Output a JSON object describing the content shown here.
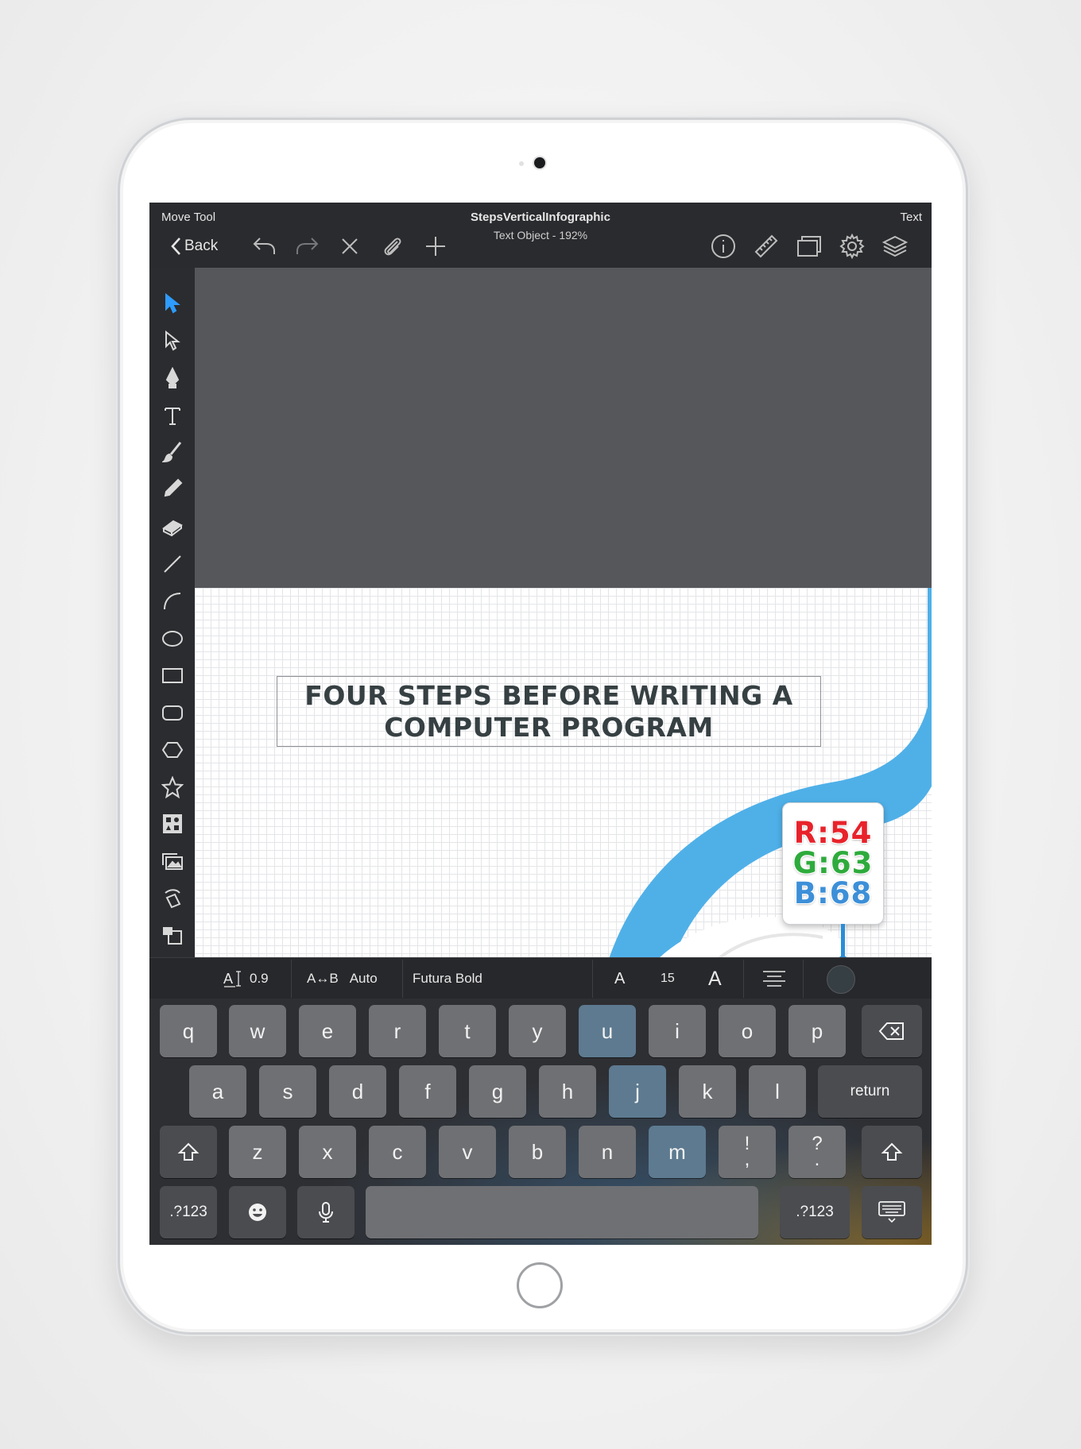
{
  "topbar": {
    "left_label": "Move Tool",
    "right_label": "Text",
    "title": "StepsVerticalInfographic",
    "subtitle": "Text Object - 192%",
    "back_label": "Back"
  },
  "canvas": {
    "headline": "FOUR STEPS BEFORE WRITING A\nCOMPUTER PROGRAM",
    "accent_color": "#4fb0e8"
  },
  "color_picker": {
    "r": "R:54",
    "g": "G:63",
    "b": "B:68",
    "swatch_color": "#363f44"
  },
  "text_props": {
    "line_spacing": "0.9",
    "tracking_icon": "A↔B",
    "tracking": "Auto",
    "font": "Futura Bold",
    "size_small_a": "A",
    "size": "15",
    "size_large_a": "A"
  },
  "keyboard": {
    "row1": [
      "q",
      "w",
      "e",
      "r",
      "t",
      "y",
      "u",
      "i",
      "o",
      "p"
    ],
    "row2": [
      "a",
      "s",
      "d",
      "f",
      "g",
      "h",
      "j",
      "k",
      "l"
    ],
    "row3": [
      "z",
      "x",
      "c",
      "v",
      "b",
      "n",
      "m"
    ],
    "return_label": "return",
    "numbers_label": ".?123",
    "exclaim_top": "!",
    "exclaim_bottom": ",",
    "question_top": "?",
    "question_bottom": "."
  }
}
